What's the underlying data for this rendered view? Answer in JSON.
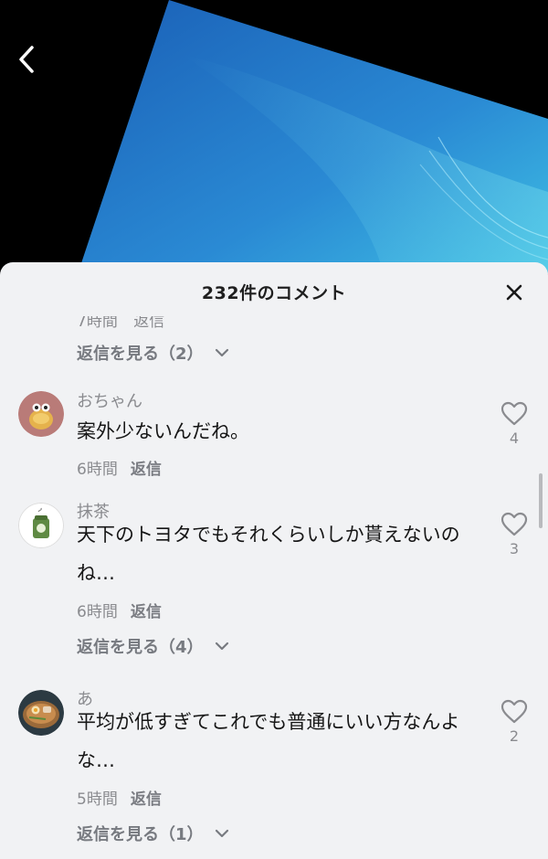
{
  "header": {
    "title": "232件のコメント"
  },
  "partial_meta": {
    "time": "7時間",
    "reply": "返信"
  },
  "comments": [
    {
      "username": "おちゃん",
      "text": "案外少ないんだね。",
      "time": "6時間",
      "reply_label": "返信",
      "likes": "4",
      "view_replies": ""
    },
    {
      "username": "抹茶",
      "text": "天下のトヨタでもそれくらいしか貰えないのね…",
      "time": "6時間",
      "reply_label": "返信",
      "likes": "3",
      "view_replies": "返信を見る（4）"
    },
    {
      "username": "あ",
      "text": "平均が低すぎてこれでも普通にいい方なんよな…",
      "time": "5時間",
      "reply_label": "返信",
      "likes": "2",
      "view_replies": "返信を見る（1）"
    }
  ],
  "top_view_replies": "返信を見る（2）",
  "icons": {
    "back": "chevron-left-icon",
    "close": "close-icon",
    "like": "heart-outline-icon",
    "expand": "chevron-down-icon"
  },
  "colors": {
    "sheet_bg": "#f1f2f4",
    "muted_text": "#8a8b8f",
    "primary_text": "#161616"
  }
}
